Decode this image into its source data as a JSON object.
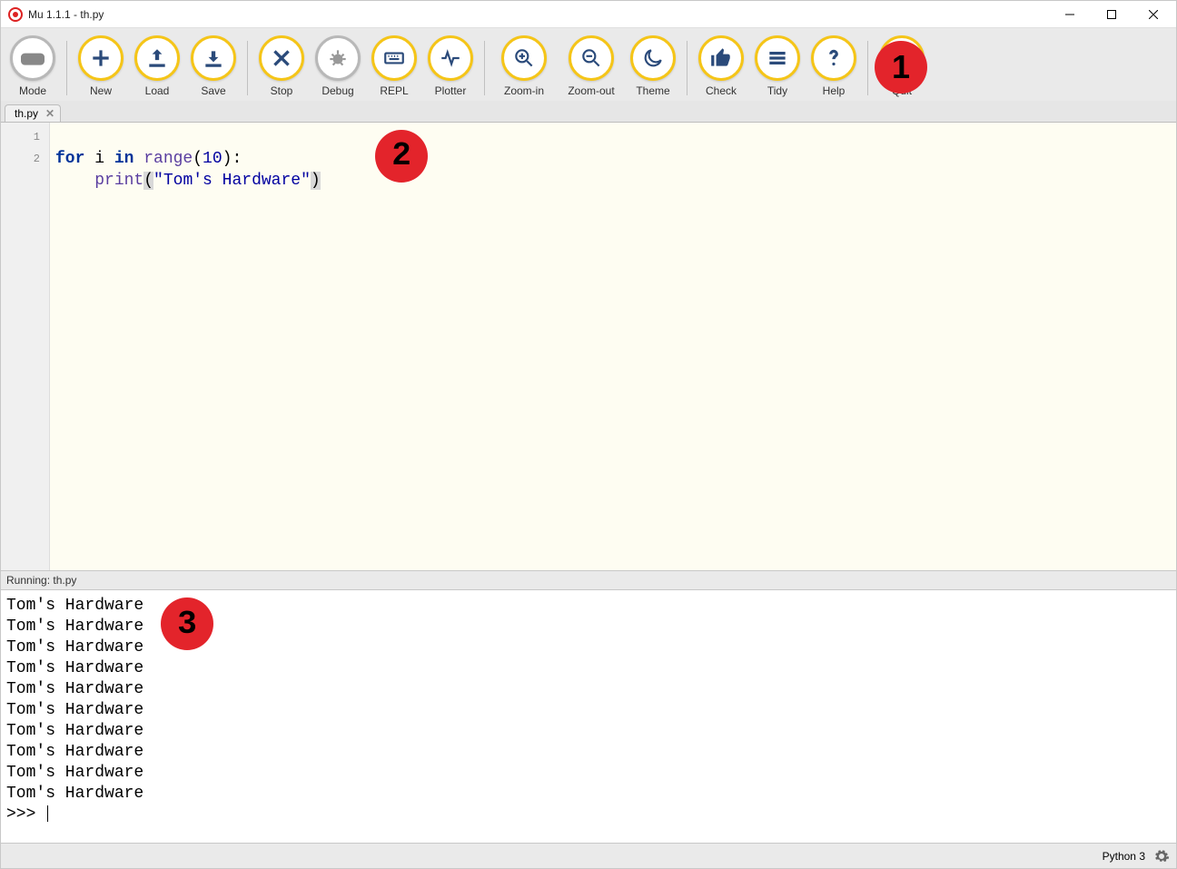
{
  "window": {
    "title": "Mu 1.1.1 - th.py"
  },
  "toolbar": {
    "mode": "Mode",
    "new": "New",
    "load": "Load",
    "save": "Save",
    "stop": "Stop",
    "debug": "Debug",
    "repl": "REPL",
    "plotter": "Plotter",
    "zoom_in": "Zoom-in",
    "zoom_out": "Zoom-out",
    "theme": "Theme",
    "check": "Check",
    "tidy": "Tidy",
    "help": "Help",
    "quit": "Quit"
  },
  "tab": {
    "name": "th.py"
  },
  "code": {
    "lines": [
      "1",
      "2"
    ],
    "l1_kw1": "for",
    "l1_var": " i ",
    "l1_kw2": "in",
    "l1_fn": " range",
    "l1_open": "(",
    "l1_num": "10",
    "l1_close": "):",
    "l2_indent": "    ",
    "l2_fn": "print",
    "l2_open": "(",
    "l2_str": "\"Tom's Hardware\"",
    "l2_close": ")"
  },
  "callouts": {
    "one": "1",
    "two": "2",
    "three": "3"
  },
  "runner": {
    "header": "Running: th.py",
    "lines": [
      "Tom's Hardware",
      "Tom's Hardware",
      "Tom's Hardware",
      "Tom's Hardware",
      "Tom's Hardware",
      "Tom's Hardware",
      "Tom's Hardware",
      "Tom's Hardware",
      "Tom's Hardware",
      "Tom's Hardware"
    ],
    "prompt": ">>> "
  },
  "status": {
    "mode": "Python 3"
  }
}
